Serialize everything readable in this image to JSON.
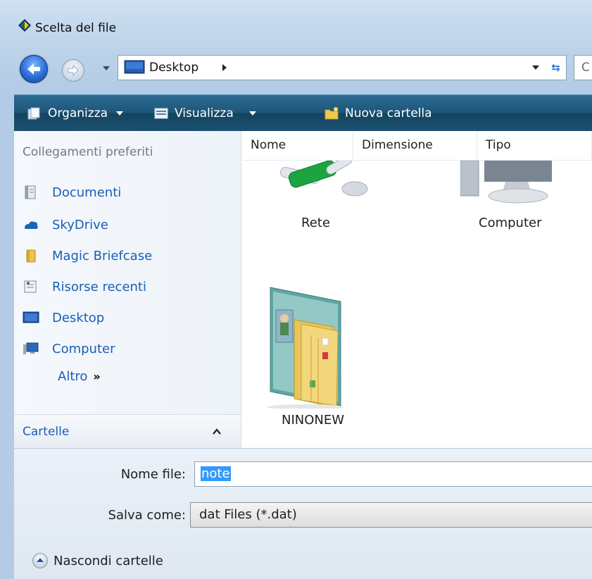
{
  "window": {
    "title": "Scelta del file"
  },
  "address": {
    "location": "Desktop",
    "search_placeholder": "C"
  },
  "toolbar": {
    "organize_label": "Organizza",
    "views_label": "Visualizza",
    "new_folder_label": "Nuova cartella"
  },
  "nav": {
    "header": "Collegamenti preferiti",
    "items": [
      {
        "label": "Documenti",
        "icon": "documents-icon"
      },
      {
        "label": "SkyDrive",
        "icon": "skydrive-icon"
      },
      {
        "label": "Magic Briefcase",
        "icon": "briefcase-icon"
      },
      {
        "label": "Risorse recenti",
        "icon": "recent-items-icon"
      },
      {
        "label": "Desktop",
        "icon": "desktop-icon"
      },
      {
        "label": "Computer",
        "icon": "computer-icon"
      }
    ],
    "more_label": "Altro",
    "more_chevron": "»",
    "folders_label": "Cartelle"
  },
  "columns": [
    "Nome",
    "Dimensione",
    "Tipo"
  ],
  "files": [
    {
      "name": "Rete",
      "icon": "network-icon"
    },
    {
      "name": "Computer",
      "icon": "computer-icon"
    },
    {
      "name": "NINONEW",
      "icon": "user-folder-icon"
    }
  ],
  "form": {
    "filename_label": "Nome file:",
    "filename_value": "note",
    "saveas_label": "Salva come:",
    "saveas_value": "dat Files (*.dat)"
  },
  "footer": {
    "hide_folders_label": "Nascondi cartelle"
  },
  "colors": {
    "link": "#1a5fb4",
    "command_bar": "#1e5679",
    "selection": "#3399ff"
  }
}
